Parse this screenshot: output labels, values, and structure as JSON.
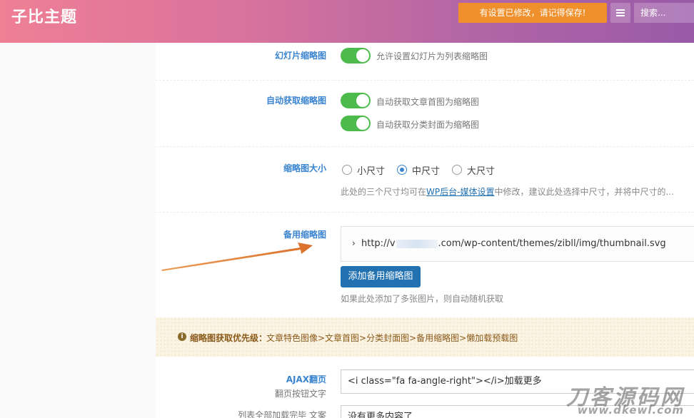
{
  "header": {
    "title": "子比主题",
    "save_notice": "有设置已修改，请记得保存!",
    "search_placeholder": "搜索..."
  },
  "settings": {
    "slide_thumb": {
      "label": "幻灯片缩略图",
      "toggle_text": "允许设置幻灯片为列表缩略图",
      "enabled": true
    },
    "auto_thumb": {
      "label": "自动获取缩略图",
      "options": [
        {
          "text": "自动获取文章首图为缩略图",
          "enabled": true
        },
        {
          "text": "自动获取分类封面为缩略图",
          "enabled": true
        }
      ]
    },
    "thumb_size": {
      "label": "缩略图大小",
      "options": [
        "小尺寸",
        "中尺寸",
        "大尺寸"
      ],
      "selected": "中尺寸",
      "desc_before": "此处的三个尺寸均可在",
      "desc_link": "WP后台-媒体设置",
      "desc_after": "中修改，建议此处选择中尺寸，并将中尺寸的..."
    },
    "backup_thumb": {
      "label": "备用缩略图",
      "url_prefix": "http://v",
      "url_suffix": ".com/wp-content/themes/zibll/img/thumbnail.svg",
      "add_button": "添加备用缩略图",
      "desc": "如果此处添加了多张图片，则自动随机获取"
    },
    "priority_notice": {
      "label": "缩略图获取优先级：",
      "text": "文章特色图像>文章首图>分类封面图>备用缩略图>懒加载预载图"
    },
    "ajax_page": {
      "label": "AJAX翻页",
      "sublabel": "翻页按钮文字",
      "value": "<i class=\"fa fa-angle-right\"></i>加载更多"
    },
    "list_done": {
      "label": "列表全部加载完毕 文案",
      "value": "没有更多内容了"
    }
  },
  "watermark": {
    "cn": "刀客源码网",
    "url": "www.dkewl.com"
  },
  "colors": {
    "toggle_on": "#4cbb4c",
    "accent_blue": "#2271b1",
    "label_blue": "#3a84d0",
    "notice_orange": "#f0902c",
    "arrow": "#e07a2e"
  }
}
